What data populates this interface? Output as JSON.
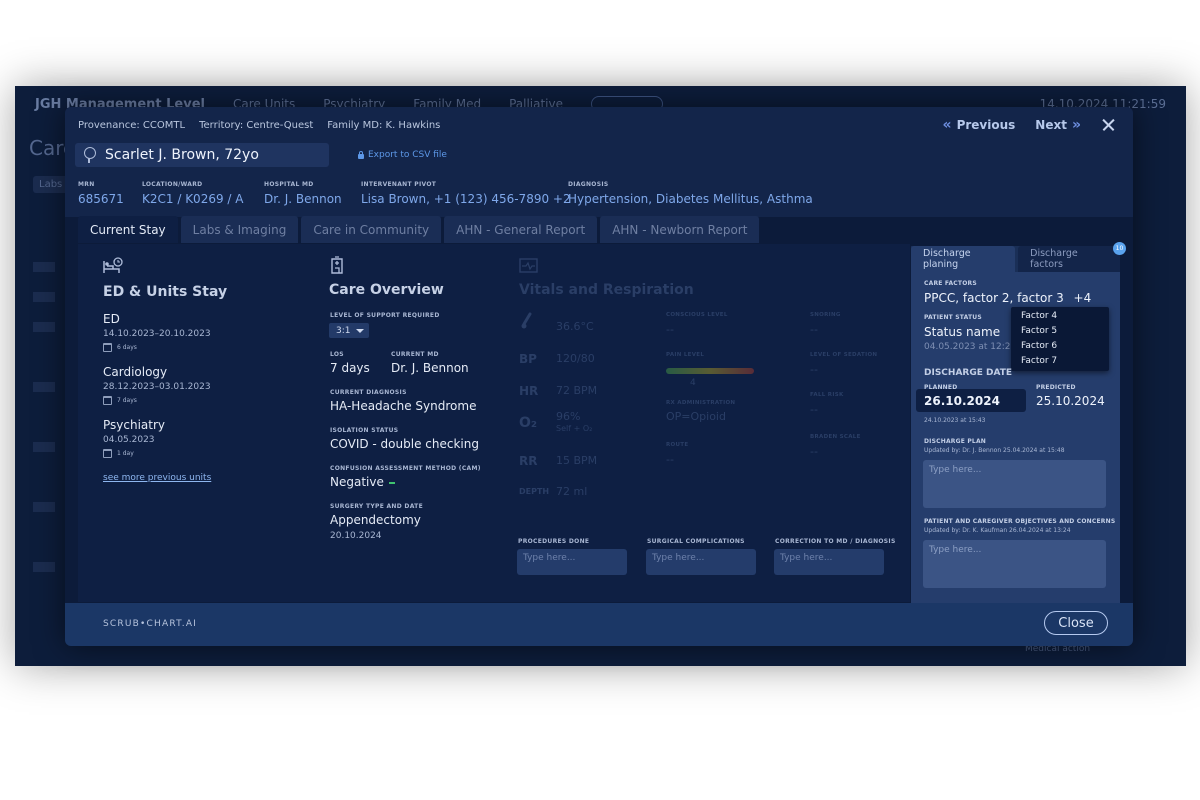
{
  "background": {
    "title": "JGH Management Level",
    "nav": [
      "Care Units",
      "Psychiatry",
      "Family Med",
      "Palliative"
    ],
    "datetime": "14.10.2024 11:21:59",
    "heading": "Care",
    "chip": "Labs",
    "footer_text": "Medical action"
  },
  "meta": {
    "provenance": "Provenance: CCOMTL",
    "territory": "Territory: Centre-Quest",
    "family_md": "Family MD: K. Hawkins"
  },
  "nav": {
    "previous": "Previous",
    "next": "Next"
  },
  "patient": {
    "name": "Scarlet J. Brown, 72yo",
    "export_label": "Export to CSV file"
  },
  "info": [
    {
      "label": "MRN",
      "value": "685671"
    },
    {
      "label": "LOCATION/WARD",
      "value": "K2C1 / K0269 / A"
    },
    {
      "label": "HOSPITAL MD",
      "value": "Dr. J. Bennon"
    },
    {
      "label": "INTERVENANT PIVOT",
      "value": "Lisa Brown, +1 (123) 456-7890 +2"
    },
    {
      "label": "DIAGNOSIS",
      "value": "Hypertension, Diabetes Mellitus, Asthma"
    }
  ],
  "tabs": [
    "Current Stay",
    "Labs & Imaging",
    "Care in Community",
    "AHN - General Report",
    "AHN - Newborn Report"
  ],
  "stay": {
    "title": "ED & Units Stay",
    "units": [
      {
        "name": "ED",
        "dates": "14.10.2023–20.10.2023",
        "days": "6 days"
      },
      {
        "name": "Cardiology",
        "dates": "28.12.2023–03.01.2023",
        "days": "7 days"
      },
      {
        "name": "Psychiatry",
        "dates": "04.05.2023",
        "days": "1 day"
      }
    ],
    "see_more": "see more previous units"
  },
  "overview": {
    "title": "Care Overview",
    "support_label": "LEVEL OF SUPPORT REQUIRED",
    "support_value": "3:1",
    "los_label": "LOS",
    "los_value": "7 days",
    "current_md_label": "CURRENT MD",
    "current_md_value": "Dr. J. Bennon",
    "diagnosis_label": "CURRENT DIAGNOSIS",
    "diagnosis_value": "HA-Headache Syndrome",
    "isolation_label": "ISOLATION STATUS",
    "isolation_value": "COVID - double checking",
    "cam_label": "CONFUSION ASSESSMENT METHOD (CAM)",
    "cam_value": "Negative",
    "surgery_label": "SURGERY TYPE AND DATE",
    "surgery_value": "Appendectomy",
    "surgery_date": "20.10.2024"
  },
  "vitals": {
    "title": "Vitals and Respiration",
    "temp": "36.6°C",
    "bp_label": "BP",
    "bp_value": "120/80",
    "hr_label": "HR",
    "hr_value": "72 BPM",
    "o2_label": "O₂",
    "o2_value": "96%",
    "o2_sub": "Self + O₂",
    "rr_label": "RR",
    "rr_value": "15 BPM",
    "depth_label": "DEPTH",
    "depth_value": "72 ml",
    "conscious_label": "CONSCIOUS LEVEL",
    "pain_label": "PAIN LEVEL",
    "pain_value": "4",
    "rx_label": "RX ADMINISTRATION",
    "rx_value": "OP=Opioid",
    "route_label": "ROUTE",
    "snoring_label": "SNORING",
    "sedation_label": "LEVEL OF SEDATION",
    "fall_label": "FALL RISK",
    "braden_label": "BRADEN SCALE",
    "dash": "--"
  },
  "procedures": [
    {
      "label": "PROCEDURES DONE",
      "placeholder": "Type here..."
    },
    {
      "label": "SURGICAL COMPLICATIONS",
      "placeholder": "Type here..."
    },
    {
      "label": "CORRECTION TO MD / DIAGNOSIS",
      "placeholder": "Type here..."
    }
  ],
  "discharge": {
    "tab_planning": "Discharge planing",
    "tab_factors": "Discharge factors",
    "factor_count": "10",
    "care_factors_label": "CARE FACTORS",
    "care_factors_value": "PPCC, factor 2, factor 3",
    "care_factors_more": "+4",
    "patient_status_label": "PATIENT STATUS",
    "patient_status_value": "Status name",
    "patient_status_date": "04.05.2023 at 12:23",
    "dropdown_options": [
      "Factor 4",
      "Factor 5",
      "Factor 6",
      "Factor 7"
    ],
    "date_heading": "DISCHARGE DATE",
    "planned_label": "PLANNED",
    "planned_value": "26.10.2024",
    "planned_sub": "24.10.2023 at 15:43",
    "predicted_label": "PREDICTED",
    "predicted_value": "25.10.2024",
    "plan_label": "DISCHARGE PLAN",
    "plan_updated": "Updated by: Dr. J. Bennon 25.04.2024 at 15:48",
    "plan_placeholder": "Type here...",
    "objectives_label": "PATIENT AND CAREGIVER OBJECTIVES AND CONCERNS",
    "objectives_updated": "Updated by: Dr. K. Kaufman 26.04.2024 at 13:24",
    "objectives_placeholder": "Type here..."
  },
  "footer": {
    "brand": "SCRUB•CHART.AI",
    "close": "Close"
  }
}
